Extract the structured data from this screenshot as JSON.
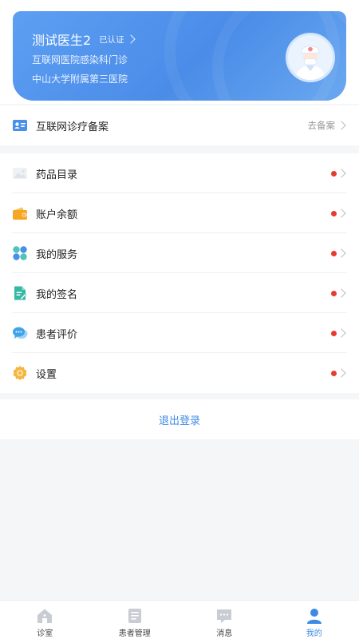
{
  "profile": {
    "name": "测试医生2",
    "verified_label": "已认证",
    "department": "互联网医院感染科门诊",
    "hospital": "中山大学附属第三医院"
  },
  "record": {
    "label": "互联网诊疗备案",
    "action": "去备案",
    "icon": "id-card-icon"
  },
  "menu": [
    {
      "label": "药品目录",
      "icon": "image-icon",
      "has_dot": true
    },
    {
      "label": "账户余额",
      "icon": "wallet-icon",
      "has_dot": true
    },
    {
      "label": "我的服务",
      "icon": "grid-icon",
      "has_dot": true
    },
    {
      "label": "我的签名",
      "icon": "document-sign-icon",
      "has_dot": true
    },
    {
      "label": "患者评价",
      "icon": "chat-bubble-icon",
      "has_dot": true
    },
    {
      "label": "设置",
      "icon": "gear-icon",
      "has_dot": true
    }
  ],
  "logout_label": "退出登录",
  "tabbar": {
    "active": 3,
    "items": [
      {
        "label": "诊室",
        "icon": "home-icon"
      },
      {
        "label": "患者管理",
        "icon": "folder-icon"
      },
      {
        "label": "消息",
        "icon": "message-icon"
      },
      {
        "label": "我的",
        "icon": "person-icon"
      }
    ]
  },
  "colors": {
    "card_gradient": "#4a8ce8",
    "accent": "#3d8ae5",
    "dot_red": "#e63c2d",
    "background": "#f5f6f8"
  }
}
